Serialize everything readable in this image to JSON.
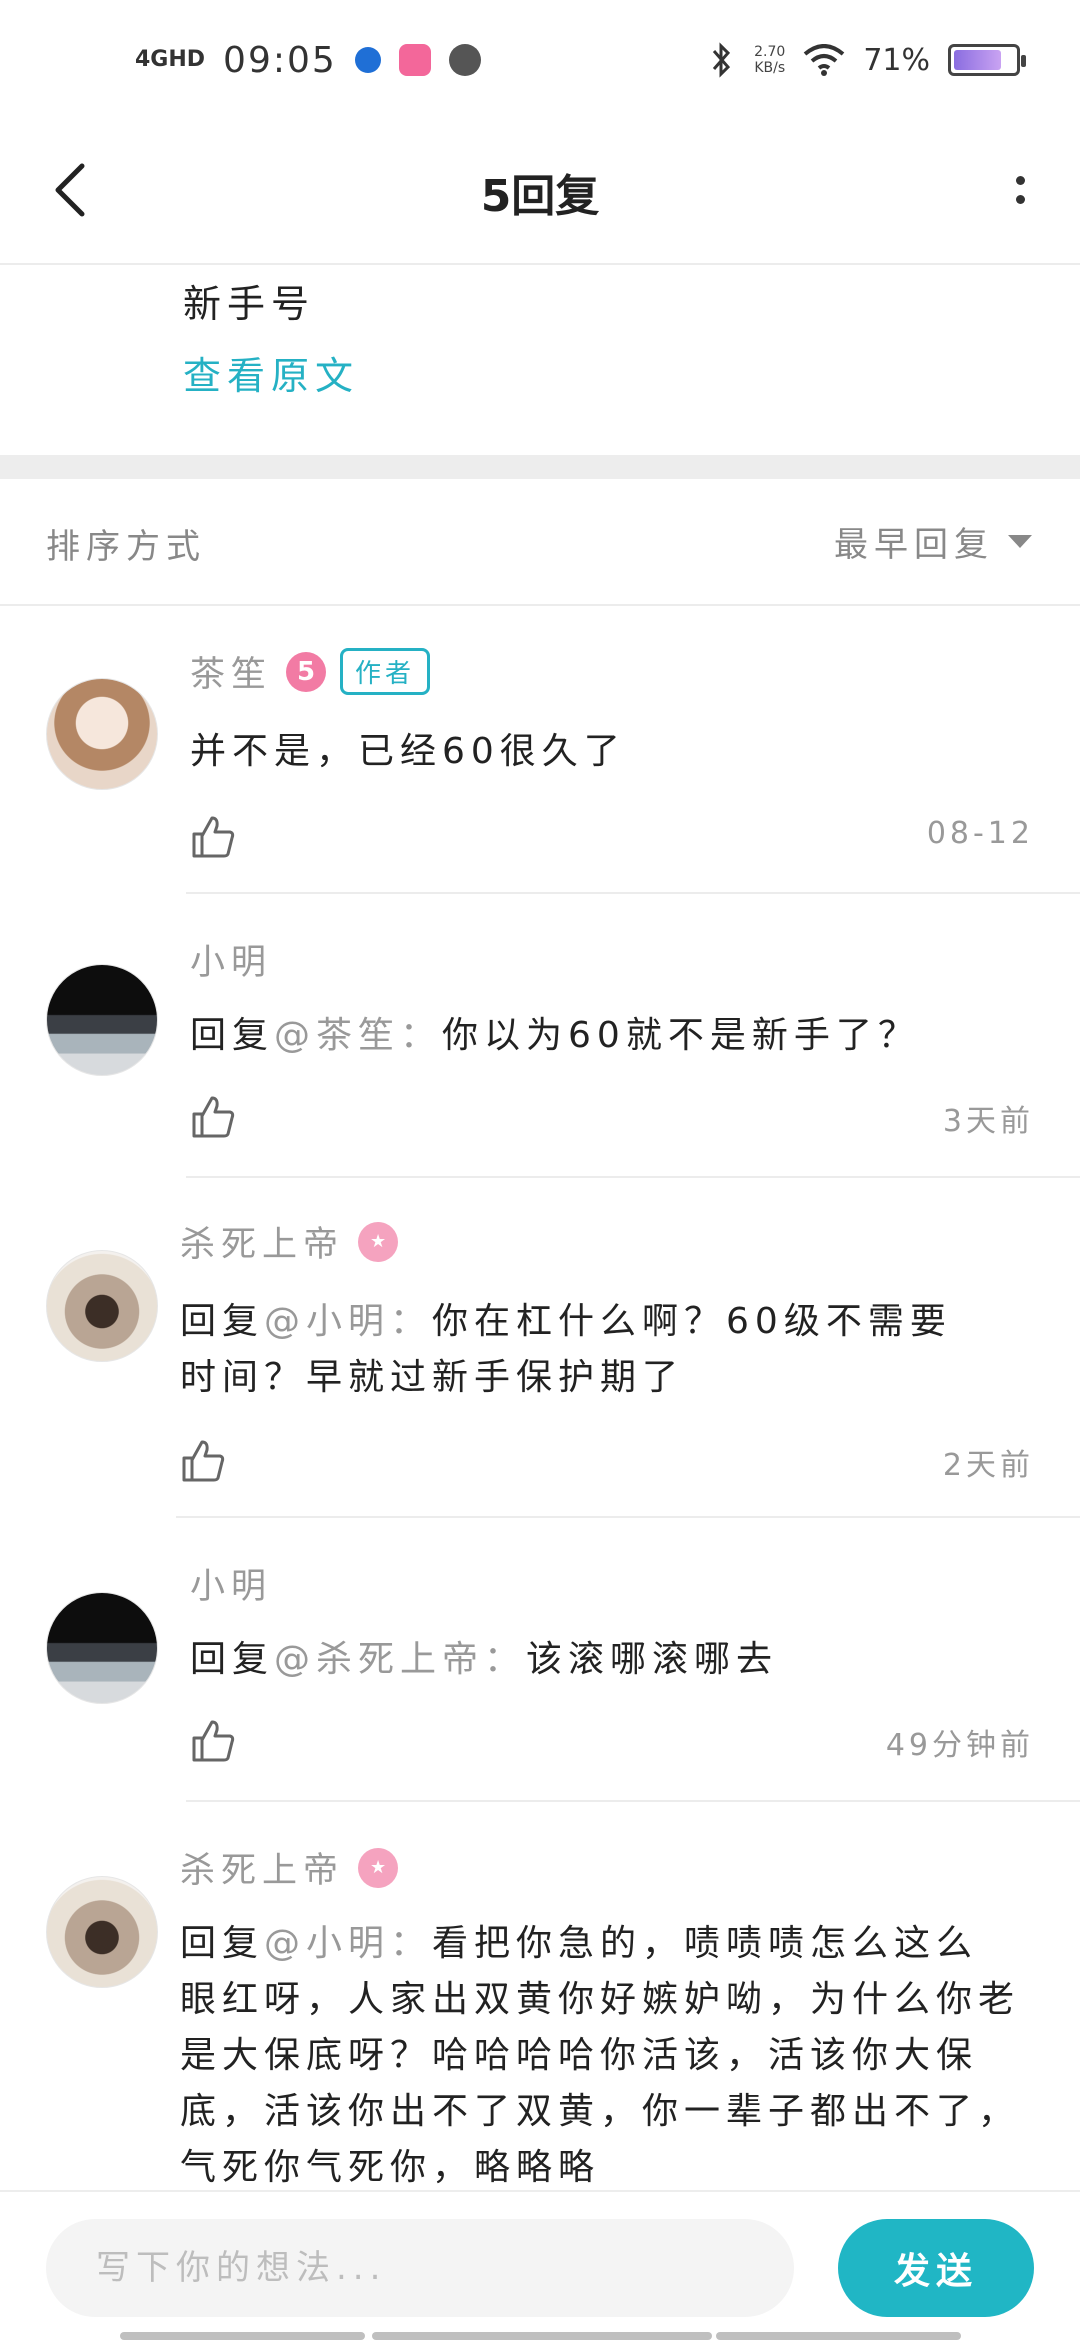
{
  "status_bar": {
    "network": "4GHD",
    "time": "09:05",
    "net_speed": "2.70",
    "net_speed_unit": "KB/s",
    "battery_percent": "71%",
    "battery_level": 0.71,
    "icons": [
      "browser-icon",
      "bilibili-icon",
      "clock-app-icon",
      "bluetooth-icon",
      "wifi-icon"
    ]
  },
  "header": {
    "title": "5回复"
  },
  "original_post": {
    "text": "新手号",
    "view_original_label": "查看原文"
  },
  "sort": {
    "label": "排序方式",
    "value": "最早回复"
  },
  "comments": [
    {
      "name": "茶笙",
      "level": "5",
      "author_tag": "作者",
      "text": "并不是，已经60很久了",
      "time": "08-12"
    },
    {
      "name": "小明",
      "reply_prefix": "回复",
      "mention": "@茶笙：",
      "text": "你以为60就不是新手了？",
      "time": "3天前"
    },
    {
      "name": "杀死上帝",
      "reply_prefix": "回复",
      "mention": "@小明：",
      "text": "你在杠什么啊？60级不需要时间？早就过新手保护期了",
      "time": "2天前"
    },
    {
      "name": "小明",
      "reply_prefix": "回复",
      "mention": "@杀死上帝：",
      "text": "该滚哪滚哪去",
      "time": "49分钟前"
    },
    {
      "name": "杀死上帝",
      "reply_prefix": "回复",
      "mention": "@小明：",
      "text": "看把你急的，啧啧啧怎么这么眼红呀，人家出双黄你好嫉妒呦，为什么你老是大保底呀？哈哈哈哈你活该，活该你大保底，活该你出不了双黄，你一辈子都出不了，气死你气死你，略略略"
    }
  ],
  "composer": {
    "placeholder": "写下你的想法...",
    "send_label": "发送"
  }
}
